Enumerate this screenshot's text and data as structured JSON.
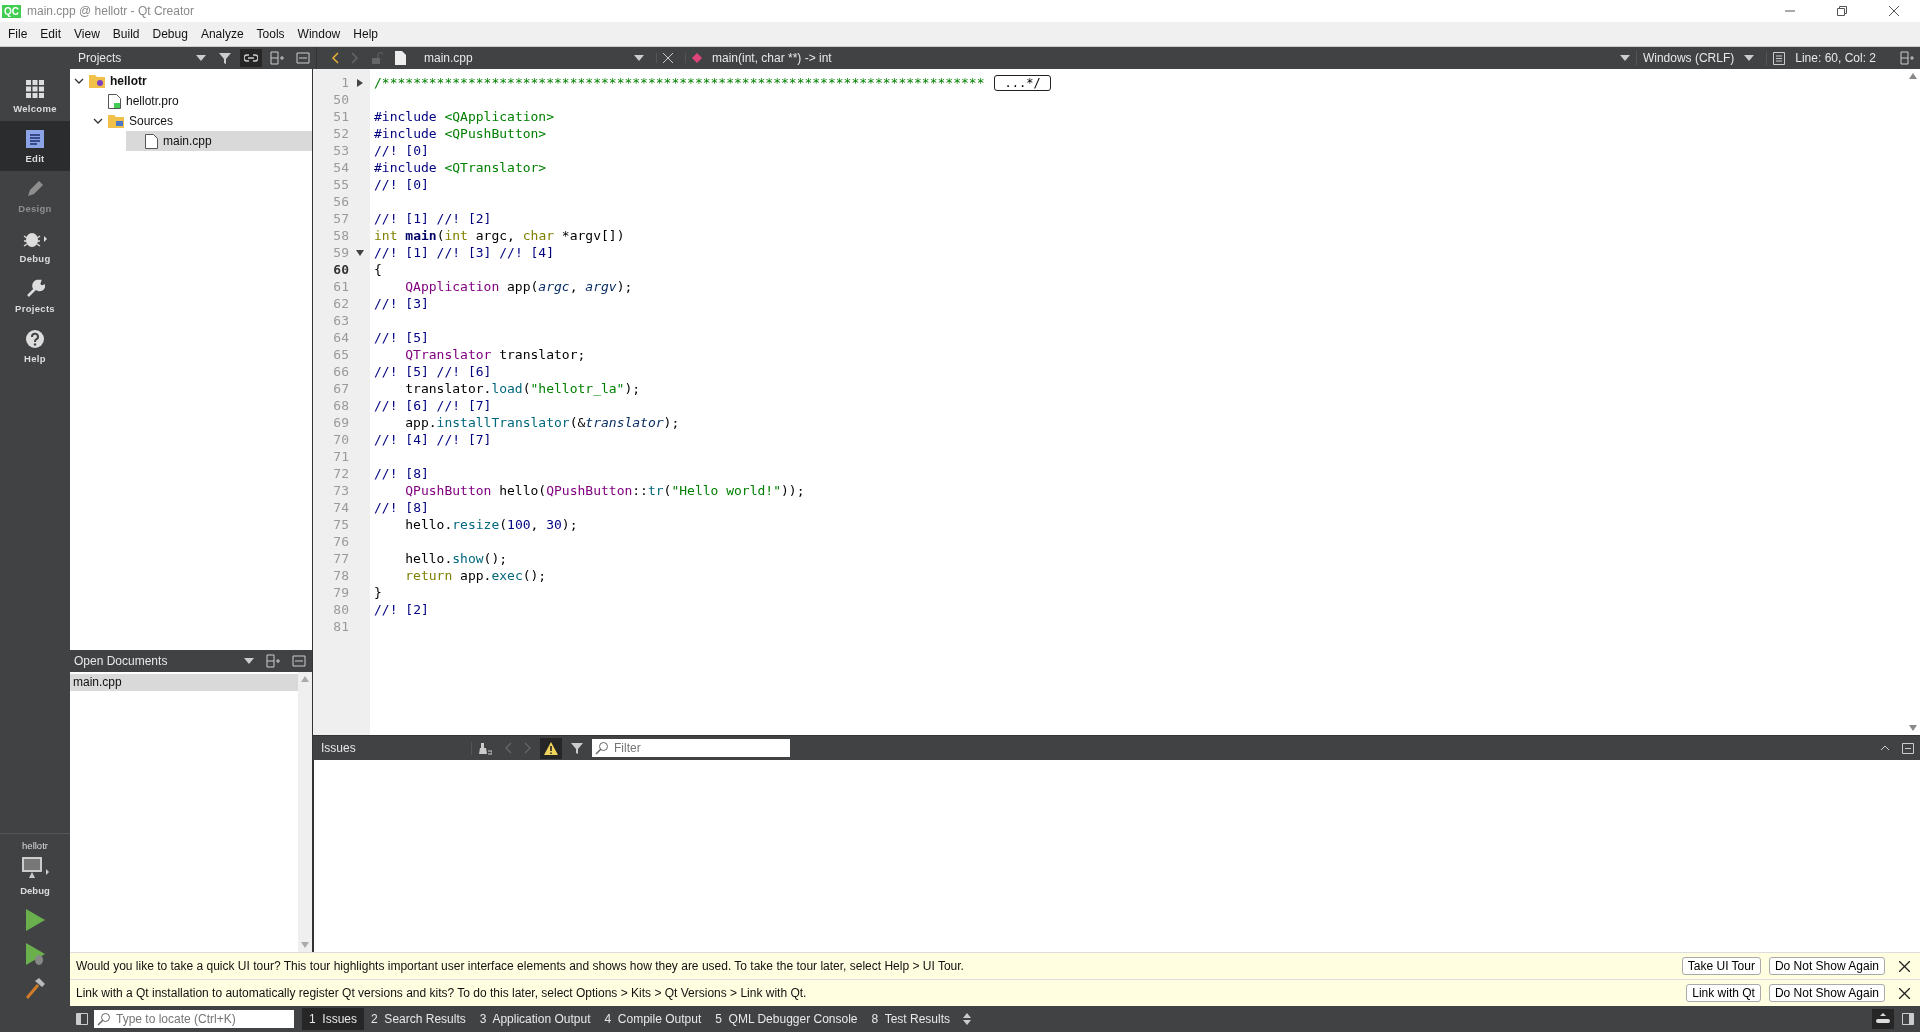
{
  "window": {
    "app_icon": "QC",
    "title": "main.cpp @ hellotr - Qt Creator"
  },
  "menu": [
    "File",
    "Edit",
    "View",
    "Build",
    "Debug",
    "Analyze",
    "Tools",
    "Window",
    "Help"
  ],
  "modes": [
    {
      "label": "Welcome",
      "kind": "welcome",
      "selected": false,
      "disabled": false
    },
    {
      "label": "Edit",
      "kind": "edit",
      "selected": true,
      "disabled": false
    },
    {
      "label": "Design",
      "kind": "design",
      "selected": false,
      "disabled": true
    },
    {
      "label": "Debug",
      "kind": "debug",
      "selected": false,
      "disabled": false
    },
    {
      "label": "Projects",
      "kind": "projects",
      "selected": false,
      "disabled": false
    },
    {
      "label": "Help",
      "kind": "help",
      "selected": false,
      "disabled": false
    }
  ],
  "target": {
    "project": "hellotr",
    "config": "Debug"
  },
  "projects_panel": {
    "title": "Projects",
    "tree": [
      {
        "label": "hellotr",
        "kind": "project",
        "expanded": true,
        "selected": false,
        "children": [
          {
            "label": "hellotr.pro",
            "kind": "profile",
            "selected": false
          },
          {
            "label": "Sources",
            "kind": "folder",
            "expanded": true,
            "selected": false,
            "children": [
              {
                "label": "main.cpp",
                "kind": "file",
                "selected": true
              }
            ]
          }
        ]
      }
    ]
  },
  "open_documents": {
    "title": "Open Documents",
    "items": [
      {
        "label": "main.cpp",
        "selected": true
      }
    ]
  },
  "editor_toolbar": {
    "file": "main.cpp",
    "symbol": "main(int, char **) -> int",
    "line_ending": "Windows (CRLF)",
    "position": "Line: 60, Col: 2"
  },
  "editor": {
    "lines": [
      {
        "number": "1",
        "current": false,
        "expanded": false,
        "tokens": [
          {
            "kind": "comment_block",
            "text": "/*****************************************************************************"
          },
          {
            "kind": "fold_box",
            "text": "...*/"
          }
        ]
      },
      {
        "number": "50",
        "current": false
      },
      {
        "number": "51",
        "current": false,
        "tokens": [
          {
            "kind": "preproc",
            "text": "#include "
          },
          {
            "kind": "string",
            "text": "<QApplication>"
          }
        ]
      },
      {
        "number": "52",
        "current": false,
        "tokens": [
          {
            "kind": "preproc",
            "text": "#include "
          },
          {
            "kind": "string",
            "text": "<QPushButton>"
          }
        ]
      },
      {
        "number": "53",
        "current": false,
        "tokens": [
          {
            "kind": "comment",
            "text": "//! [0]"
          }
        ]
      },
      {
        "number": "54",
        "current": false,
        "tokens": [
          {
            "kind": "preproc",
            "text": "#include "
          },
          {
            "kind": "string",
            "text": "<QTranslator>"
          }
        ]
      },
      {
        "number": "55",
        "current": false,
        "tokens": [
          {
            "kind": "comment",
            "text": "//! [0]"
          }
        ]
      },
      {
        "number": "56",
        "current": false
      },
      {
        "number": "57",
        "current": false,
        "tokens": [
          {
            "kind": "comment",
            "text": "//! [1] //! [2]"
          }
        ]
      },
      {
        "number": "58",
        "current": false,
        "tokens": [
          {
            "kind": "keyword",
            "text": "int "
          },
          {
            "kind": "decl",
            "text": "main"
          },
          {
            "kind": "plain",
            "text": "("
          },
          {
            "kind": "keyword",
            "text": "int"
          },
          {
            "kind": "plain",
            "text": " argc, "
          },
          {
            "kind": "keyword",
            "text": "char"
          },
          {
            "kind": "plain",
            "text": " *argv[])"
          }
        ]
      },
      {
        "number": "59",
        "current": false,
        "expanded": true,
        "tokens": [
          {
            "kind": "comment",
            "text": "//! [1] //! [3] //! [4]"
          }
        ]
      },
      {
        "number": "60",
        "current": true,
        "tokens": [
          {
            "kind": "plain",
            "text": "{"
          }
        ]
      },
      {
        "number": "61",
        "current": false,
        "indent": true,
        "tokens": [
          {
            "kind": "type",
            "text": "QApplication"
          },
          {
            "kind": "plain",
            "text": " app("
          },
          {
            "kind": "param",
            "text": "argc"
          },
          {
            "kind": "plain",
            "text": ", "
          },
          {
            "kind": "param",
            "text": "argv"
          },
          {
            "kind": "plain",
            "text": ");"
          }
        ]
      },
      {
        "number": "62",
        "current": false,
        "tokens": [
          {
            "kind": "comment",
            "text": "//! [3]"
          }
        ]
      },
      {
        "number": "63",
        "current": false
      },
      {
        "number": "64",
        "current": false,
        "tokens": [
          {
            "kind": "comment",
            "text": "//! [5]"
          }
        ]
      },
      {
        "number": "65",
        "current": false,
        "indent": true,
        "tokens": [
          {
            "kind": "type",
            "text": "QTranslator"
          },
          {
            "kind": "plain",
            "text": " translator;"
          }
        ]
      },
      {
        "number": "66",
        "current": false,
        "tokens": [
          {
            "kind": "comment",
            "text": "//! [5] //! [6]"
          }
        ]
      },
      {
        "number": "67",
        "current": false,
        "indent": true,
        "tokens": [
          {
            "kind": "plain",
            "text": "translator."
          },
          {
            "kind": "func",
            "text": "load"
          },
          {
            "kind": "plain",
            "text": "("
          },
          {
            "kind": "string",
            "text": "\"hellotr_la\""
          },
          {
            "kind": "plain",
            "text": ");"
          }
        ]
      },
      {
        "number": "68",
        "current": false,
        "tokens": [
          {
            "kind": "comment",
            "text": "//! [6] //! [7]"
          }
        ]
      },
      {
        "number": "69",
        "current": false,
        "indent": true,
        "tokens": [
          {
            "kind": "plain",
            "text": "app."
          },
          {
            "kind": "func",
            "text": "installTranslator"
          },
          {
            "kind": "plain",
            "text": "(&"
          },
          {
            "kind": "param",
            "text": "translator"
          },
          {
            "kind": "plain",
            "text": ");"
          }
        ]
      },
      {
        "number": "70",
        "current": false,
        "tokens": [
          {
            "kind": "comment",
            "text": "//! [4] //! [7]"
          }
        ]
      },
      {
        "number": "71",
        "current": false
      },
      {
        "number": "72",
        "current": false,
        "tokens": [
          {
            "kind": "comment",
            "text": "//! [8]"
          }
        ]
      },
      {
        "number": "73",
        "current": false,
        "indent": true,
        "tokens": [
          {
            "kind": "type",
            "text": "QPushButton"
          },
          {
            "kind": "plain",
            "text": " hello("
          },
          {
            "kind": "type",
            "text": "QPushButton"
          },
          {
            "kind": "plain",
            "text": "::"
          },
          {
            "kind": "func",
            "text": "tr"
          },
          {
            "kind": "plain",
            "text": "("
          },
          {
            "kind": "string",
            "text": "\"Hello world!\""
          },
          {
            "kind": "plain",
            "text": "));"
          }
        ]
      },
      {
        "number": "74",
        "current": false,
        "tokens": [
          {
            "kind": "comment",
            "text": "//! [8]"
          }
        ]
      },
      {
        "number": "75",
        "current": false,
        "indent": true,
        "tokens": [
          {
            "kind": "plain",
            "text": "hello."
          },
          {
            "kind": "func",
            "text": "resize"
          },
          {
            "kind": "plain",
            "text": "("
          },
          {
            "kind": "number",
            "text": "100"
          },
          {
            "kind": "plain",
            "text": ", "
          },
          {
            "kind": "number",
            "text": "30"
          },
          {
            "kind": "plain",
            "text": ");"
          }
        ]
      },
      {
        "number": "76",
        "current": false
      },
      {
        "number": "77",
        "current": false,
        "indent": true,
        "tokens": [
          {
            "kind": "plain",
            "text": "hello."
          },
          {
            "kind": "func",
            "text": "show"
          },
          {
            "kind": "plain",
            "text": "();"
          }
        ]
      },
      {
        "number": "78",
        "current": false,
        "indent": true,
        "tokens": [
          {
            "kind": "keyword",
            "text": "return"
          },
          {
            "kind": "plain",
            "text": " app."
          },
          {
            "kind": "func",
            "text": "exec"
          },
          {
            "kind": "plain",
            "text": "();"
          }
        ]
      },
      {
        "number": "79",
        "current": false,
        "tokens": [
          {
            "kind": "plain",
            "text": "}"
          }
        ]
      },
      {
        "number": "80",
        "current": false,
        "tokens": [
          {
            "kind": "comment",
            "text": "//! [2]"
          }
        ]
      },
      {
        "number": "81",
        "current": false
      }
    ]
  },
  "issues_pane": {
    "title": "Issues",
    "filter": {
      "placeholder": "Filter"
    }
  },
  "info_bars": [
    {
      "message": "Would you like to take a quick UI tour? This tour highlights important user interface elements and shows how they are used. To take the tour later, select Help > UI Tour.",
      "buttons": [
        "Take UI Tour",
        "Do Not Show Again"
      ]
    },
    {
      "message": "Link with a Qt installation to automatically register Qt versions and kits? To do this later, select Options > Kits > Qt Versions > Link with Qt.",
      "buttons": [
        "Link with Qt",
        "Do Not Show Again"
      ]
    }
  ],
  "status_bar": {
    "locator": {
      "placeholder": "Type to locate (Ctrl+K)"
    },
    "tabs": [
      {
        "label": "1  Issues",
        "selected": true
      },
      {
        "label": "2  Search Results",
        "selected": false
      },
      {
        "label": "3  Application Output",
        "selected": false
      },
      {
        "label": "4  Compile Output",
        "selected": false
      },
      {
        "label": "5  QML Debugger Console",
        "selected": false
      },
      {
        "label": "8  Test Results",
        "selected": false
      }
    ]
  }
}
